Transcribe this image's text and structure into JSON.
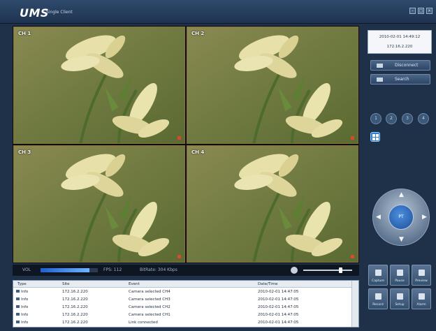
{
  "app": {
    "logo": "UMS",
    "logo_subtitle": "Single Client"
  },
  "window_controls": [
    "min",
    "max",
    "close"
  ],
  "channels": [
    {
      "label": "CH 1"
    },
    {
      "label": "CH 2"
    },
    {
      "label": "CH 3"
    },
    {
      "label": "CH 4"
    }
  ],
  "statusbar": {
    "volume_label": "VOL",
    "volume_level_pct": 85,
    "fps": "FPS: 112",
    "bitrate": "BitRate: 304 Kbps",
    "audio_slider_pct": 75
  },
  "log": {
    "columns": [
      "Type",
      "Site",
      "Event",
      "Date/Time"
    ],
    "rows": [
      {
        "type": "Info",
        "site": "172.16.2.220",
        "event": "Camera selected CH4",
        "time": "2010-02-01 14:47:05"
      },
      {
        "type": "Info",
        "site": "172.16.2.220",
        "event": "Camera selected CH3",
        "time": "2010-02-01 14:47:05"
      },
      {
        "type": "Info",
        "site": "172.16.2.220",
        "event": "Camera selected CH2",
        "time": "2010-02-01 14:47:05"
      },
      {
        "type": "Info",
        "site": "172.16.2.220",
        "event": "Camera selected CH1",
        "time": "2010-02-01 14:47:05"
      },
      {
        "type": "Info",
        "site": "172.16.2.220",
        "event": "Link connected",
        "time": "2010-02-01 14:47:05"
      }
    ]
  },
  "info": {
    "datetime": "2010-02-01 14:49:12",
    "ip": "172.16.2.220"
  },
  "side_buttons": {
    "disconnect": "Disconnect",
    "search": "Search"
  },
  "view_buttons": [
    "1",
    "2",
    "3",
    "4"
  ],
  "ptz": {
    "center_label": "PT"
  },
  "tools": [
    "Capture",
    "Pause",
    "Preview",
    "Record",
    "Setup",
    "Alarm"
  ],
  "colors": {
    "background": "#1f3148",
    "accent": "#2f7fd6",
    "cell_border": "#8a6f3a"
  }
}
